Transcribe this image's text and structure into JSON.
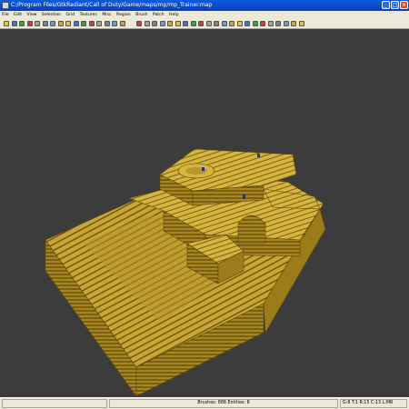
{
  "window": {
    "title": "C:/Program Files/GtkRadiant/Call of Duty/Game/maps/mp/mp_Trainer.map"
  },
  "menu": {
    "items": [
      "File",
      "Edit",
      "View",
      "Selection",
      "Grid",
      "Textures",
      "Misc",
      "Region",
      "Brush",
      "Patch",
      "Help"
    ]
  },
  "toolbar": {
    "icons": [
      "open-icon",
      "save-icon",
      "undo-icon",
      "redo-icon",
      "flip-x-icon",
      "flip-y-icon",
      "rotate-x-icon",
      "rotate-y-icon",
      "select-icon",
      "csg-icon",
      "clipper-icon",
      "camera-icon",
      "texture-icon",
      "entity-icon",
      "patch-icon",
      "lighting-icon"
    ]
  },
  "viewport": {
    "description_colors": {
      "brush_top": "#d6b43e",
      "brush_side": "#9c7c1a",
      "brush_stripe": "#6a5410",
      "background": "#3c3c3c",
      "entity_marker": "#1c2fa8"
    }
  },
  "status": {
    "left": "",
    "middle": "Brushes: 888 Entities: 8",
    "right": "G:8 T:1 R:15 C:13 L:MR"
  }
}
